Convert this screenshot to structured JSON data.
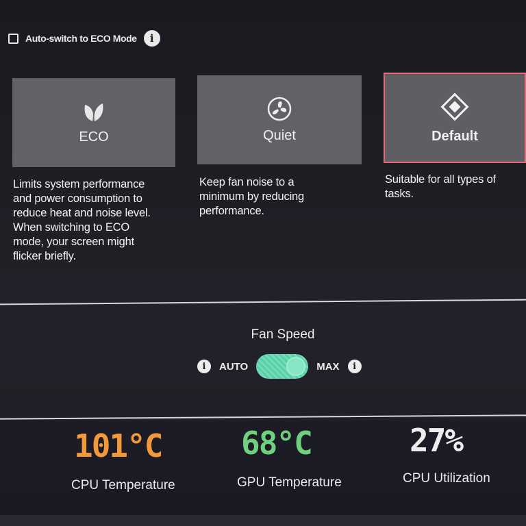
{
  "auto_switch": {
    "label": "Auto-switch to ECO Mode",
    "checked": false,
    "info_glyph": "i"
  },
  "modes": [
    {
      "name": "ECO",
      "icon": "leaf-icon",
      "selected": false,
      "description": [
        "Limits system performance",
        "and power consumption to",
        "reduce heat and noise level.",
        "When switching to ECO",
        "mode, your screen might",
        "flicker briefly."
      ]
    },
    {
      "name": "Quiet",
      "icon": "fan-icon",
      "selected": false,
      "description": [
        "Keep fan noise to a",
        "minimum by reducing",
        "performance."
      ]
    },
    {
      "name": "Default",
      "icon": "diamond-icon",
      "selected": true,
      "description": [
        "Suitable for all types of",
        "tasks."
      ]
    }
  ],
  "fan_speed": {
    "title": "Fan Speed",
    "left_option": "AUTO",
    "right_option": "MAX",
    "value": "MAX",
    "info_glyph": "i"
  },
  "stats": [
    {
      "value": "101°C",
      "label": "CPU Temperature",
      "color": "#f29a3a"
    },
    {
      "value": "68°C",
      "label": "GPU Temperature",
      "color": "#6fd17e"
    },
    {
      "value": "27%",
      "label": "CPU Utilization",
      "color": "#ededed"
    }
  ],
  "colors": {
    "selected_border": "#e66a7e",
    "toggle": "#5bcfa7",
    "card_bg": "#626166"
  }
}
